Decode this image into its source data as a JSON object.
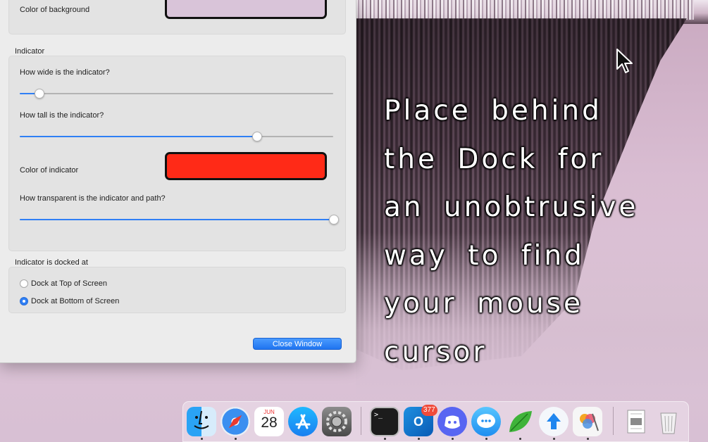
{
  "window": {
    "background": {
      "color_label": "Color of background",
      "swatch_color": "#d9c4d9"
    },
    "indicator": {
      "title": "Indicator",
      "width_label": "How wide is the indicator?",
      "width_value": 0.06,
      "height_label": "How tall is the indicator?",
      "height_value": 0.755,
      "color_label": "Color of indicator",
      "color_value": "#ff2a17",
      "transparency_label": "How transparent is the indicator and path?",
      "transparency_value": 1.0
    },
    "dock_position": {
      "title": "Indicator is docked at",
      "options": [
        {
          "label": "Dock at Top of Screen",
          "selected": false
        },
        {
          "label": "Dock at Bottom of Screen",
          "selected": true
        }
      ]
    },
    "close_button_label": "Close Window"
  },
  "desktop": {
    "message_lines": [
      "Place behind",
      "the Dock for",
      "an unobtrusive",
      "way to find",
      "your mouse",
      "cursor"
    ]
  },
  "dock": {
    "apps": [
      {
        "name": "finder-icon"
      },
      {
        "name": "safari-icon"
      },
      {
        "name": "calendar-icon",
        "month": "JUN",
        "day": "28"
      },
      {
        "name": "app-store-icon"
      },
      {
        "name": "system-preferences-icon"
      },
      {
        "name": "terminal-icon"
      },
      {
        "name": "outlook-icon",
        "badge": "377"
      },
      {
        "name": "discord-icon"
      },
      {
        "name": "messages-icon"
      },
      {
        "name": "leaf-app-icon"
      },
      {
        "name": "upload-app-icon"
      },
      {
        "name": "photos-editor-icon"
      },
      {
        "name": "preview-document-icon"
      },
      {
        "name": "trash-icon"
      }
    ]
  }
}
